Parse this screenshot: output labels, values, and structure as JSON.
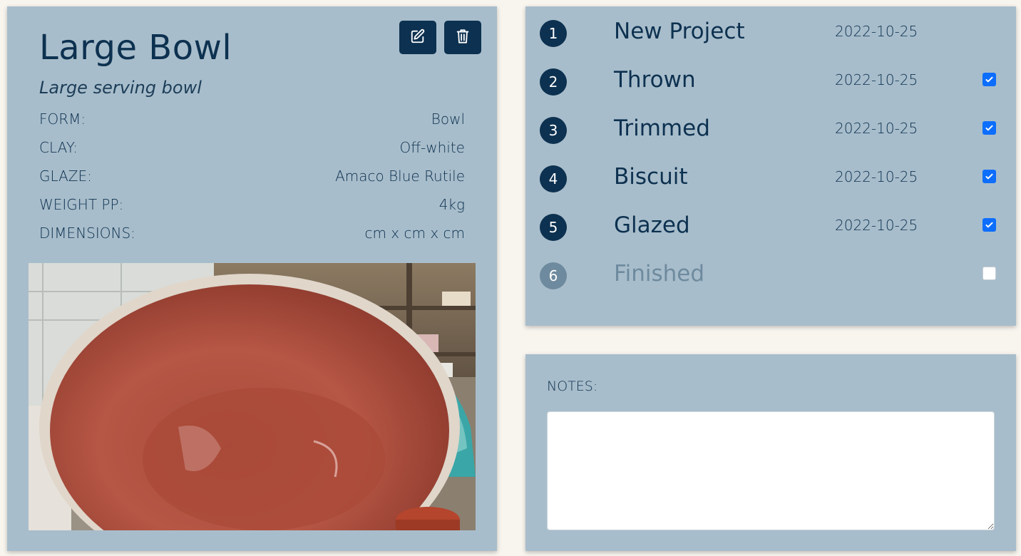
{
  "project": {
    "title": "Large Bowl",
    "subtitle": "Large serving bowl",
    "details": [
      {
        "label": "FORM:",
        "value": "Bowl"
      },
      {
        "label": "CLAY:",
        "value": "Off-white"
      },
      {
        "label": "GLAZE:",
        "value": "Amaco Blue Rutile"
      },
      {
        "label": "WEIGHT PP:",
        "value": "4kg"
      },
      {
        "label": "DIMENSIONS:",
        "value": "cm x cm x cm"
      }
    ],
    "edit_icon": "edit-icon",
    "delete_icon": "trash-icon"
  },
  "stages": [
    {
      "number": "1",
      "name": "New Project",
      "date": "2022-10-25",
      "checked": null
    },
    {
      "number": "2",
      "name": "Thrown",
      "date": "2022-10-25",
      "checked": true
    },
    {
      "number": "3",
      "name": "Trimmed",
      "date": "2022-10-25",
      "checked": true
    },
    {
      "number": "4",
      "name": "Biscuit",
      "date": "2022-10-25",
      "checked": true
    },
    {
      "number": "5",
      "name": "Glazed",
      "date": "2022-10-25",
      "checked": true
    },
    {
      "number": "6",
      "name": "Finished",
      "date": "",
      "checked": false
    }
  ],
  "notes": {
    "label": "NOTES:",
    "value": ""
  },
  "colors": {
    "card_bg": "#a8bdcb",
    "page_bg": "#f8f5ef",
    "primary": "#0d3150",
    "muted": "#6e8a9e",
    "check_blue": "#0d6efd"
  }
}
